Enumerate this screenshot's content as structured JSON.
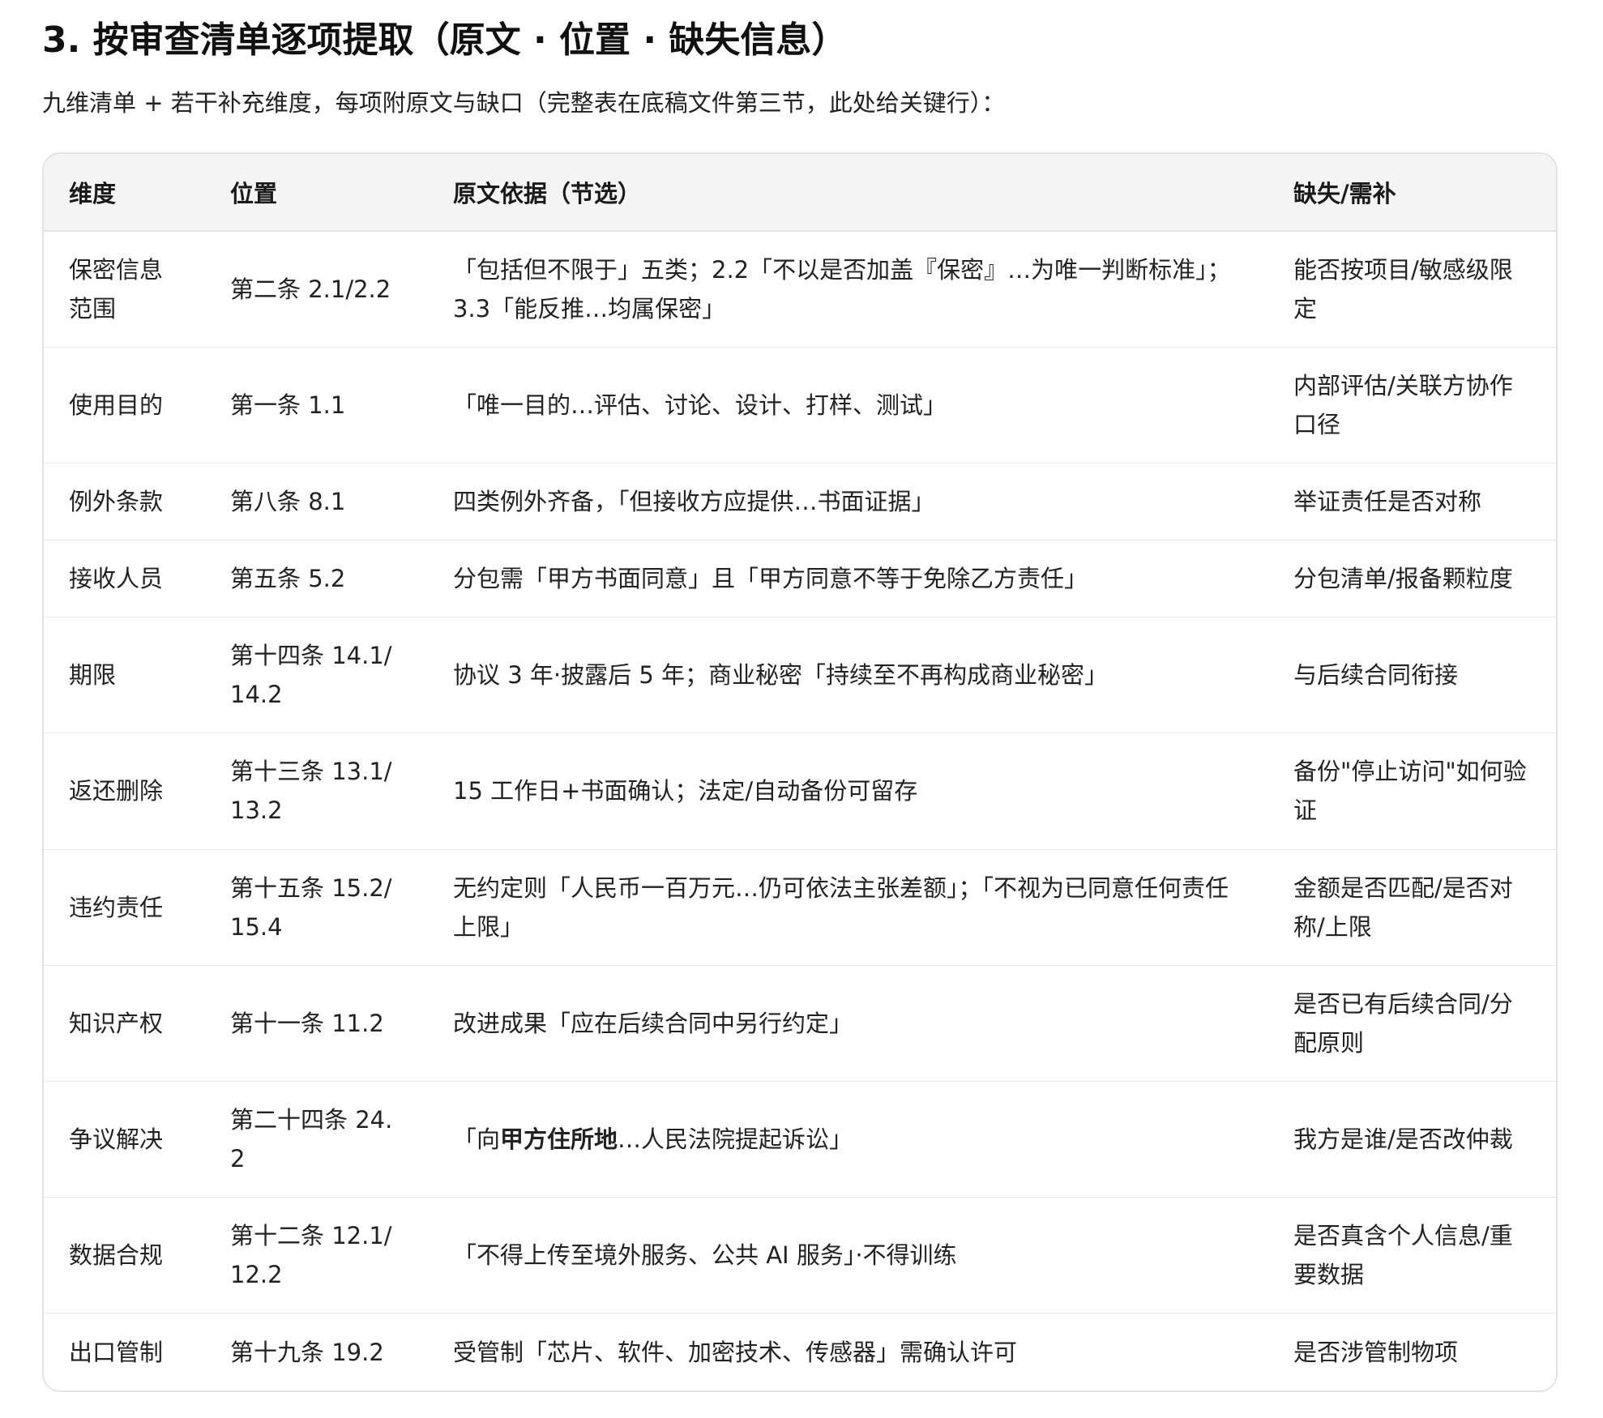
{
  "heading": "3. 按审查清单逐项提取（原文 · 位置 · 缺失信息）",
  "intro": "九维清单 + 若干补充维度，每项附原文与缺口（完整表在底稿文件第三节，此处给关键行）：",
  "table": {
    "headers": [
      "维度",
      "位置",
      "原文依据（节选）",
      "缺失/需补"
    ],
    "rows": [
      {
        "dimension": "保密信息范围",
        "location": "第二条 2.1/2.2",
        "source_pre": "",
        "source_strong": "",
        "source": "「包括但不限于」五类；2.2「不以是否加盖『保密』…为唯一判断标准」；3.3「能反推…均属保密」",
        "missing": "能否按项目/敏感级限定"
      },
      {
        "dimension": "使用目的",
        "location": "第一条 1.1",
        "source_pre": "",
        "source_strong": "",
        "source": "「唯一目的…评估、讨论、设计、打样、测试」",
        "missing": "内部评估/关联方协作口径"
      },
      {
        "dimension": "例外条款",
        "location": "第八条 8.1",
        "source_pre": "",
        "source_strong": "",
        "source": "四类例外齐备，「但接收方应提供…书面证据」",
        "missing": "举证责任是否对称"
      },
      {
        "dimension": "接收人员",
        "location": "第五条 5.2",
        "source_pre": "",
        "source_strong": "",
        "source": "分包需「甲方书面同意」且「甲方同意不等于免除乙方责任」",
        "missing": "分包清单/报备颗粒度"
      },
      {
        "dimension": "期限",
        "location": "第十四条 14.1/14.2",
        "source_pre": "",
        "source_strong": "",
        "source": "协议 3 年·披露后 5 年；商业秘密「持续至不再构成商业秘密」",
        "missing": "与后续合同衔接"
      },
      {
        "dimension": "返还删除",
        "location": "第十三条 13.1/13.2",
        "source_pre": "",
        "source_strong": "",
        "source": "15 工作日+书面确认；法定/自动备份可留存",
        "missing": "备份\"停止访问\"如何验证"
      },
      {
        "dimension": "违约责任",
        "location": "第十五条 15.2/15.4",
        "source_pre": "",
        "source_strong": "",
        "source": "无约定则「人民币一百万元…仍可依法主张差额」；「不视为已同意任何责任上限」",
        "missing": "金额是否匹配/是否对称/上限"
      },
      {
        "dimension": "知识产权",
        "location": "第十一条 11.2",
        "source_pre": "",
        "source_strong": "",
        "source": "改进成果「应在后续合同中另行约定」",
        "missing": "是否已有后续合同/分配原则"
      },
      {
        "dimension": "争议解决",
        "location": "第二十四条 24.2",
        "source_pre": "「向",
        "source_strong": "甲方住所地",
        "source": "…人民法院提起诉讼」",
        "missing": "我方是谁/是否改仲裁"
      },
      {
        "dimension": "数据合规",
        "location": "第十二条 12.1/12.2",
        "source_pre": "",
        "source_strong": "",
        "source": "「不得上传至境外服务、公共 AI 服务」·不得训练",
        "missing": "是否真含个人信息/重要数据"
      },
      {
        "dimension": "出口管制",
        "location": "第十九条 19.2",
        "source_pre": "",
        "source_strong": "",
        "source": "受管制「芯片、软件、加密技术、传感器」需确认许可",
        "missing": "是否涉管制物项"
      }
    ]
  }
}
